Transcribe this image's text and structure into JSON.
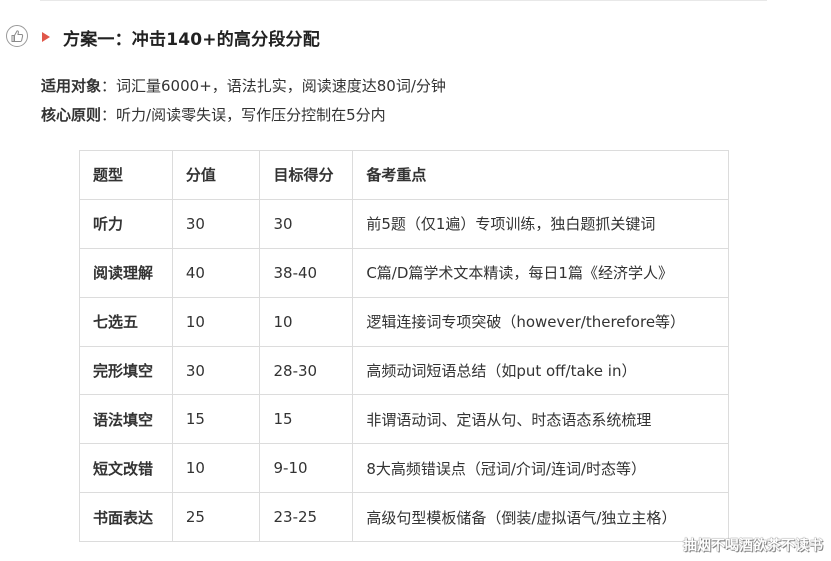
{
  "heading": {
    "title": "方案一：冲击140+的高分段分配"
  },
  "meta": {
    "target_label": "适用对象",
    "target_text": "：词汇量6000+，语法扎实，阅读速度达80词/分钟",
    "principle_label": "核心原则",
    "principle_text": "：听力/阅读零失误，写作压分控制在5分内"
  },
  "table": {
    "headers": [
      "题型",
      "分值",
      "目标得分",
      "备考重点"
    ],
    "rows": [
      [
        "听力",
        "30",
        "30",
        "前5题（仅1遍）专项训练，独白题抓关键词"
      ],
      [
        "阅读理解",
        "40",
        "38-40",
        "C篇/D篇学术文本精读，每日1篇《经济学人》"
      ],
      [
        "七选五",
        "10",
        "10",
        "逻辑连接词专项突破（however/therefore等）"
      ],
      [
        "完形填空",
        "30",
        "28-30",
        "高频动词短语总结（如put off/take in）"
      ],
      [
        "语法填空",
        "15",
        "15",
        "非谓语动词、定语从句、时态语态系统梳理"
      ],
      [
        "短文改错",
        "10",
        "9-10",
        "8大高频错误点（冠词/介词/连词/时态等）"
      ],
      [
        "书面表达",
        "25",
        "23-25",
        "高级句型模板储备（倒装/虚拟语气/独立主格）"
      ]
    ]
  },
  "watermark": "抽烟不喝酒欲茶不读书",
  "colors": {
    "marker": "#e0574a",
    "border": "#dcdcdc",
    "text": "#333333"
  },
  "icons": {
    "side": "thumbs-up-icon",
    "heading_marker": "triangle-right-icon"
  }
}
